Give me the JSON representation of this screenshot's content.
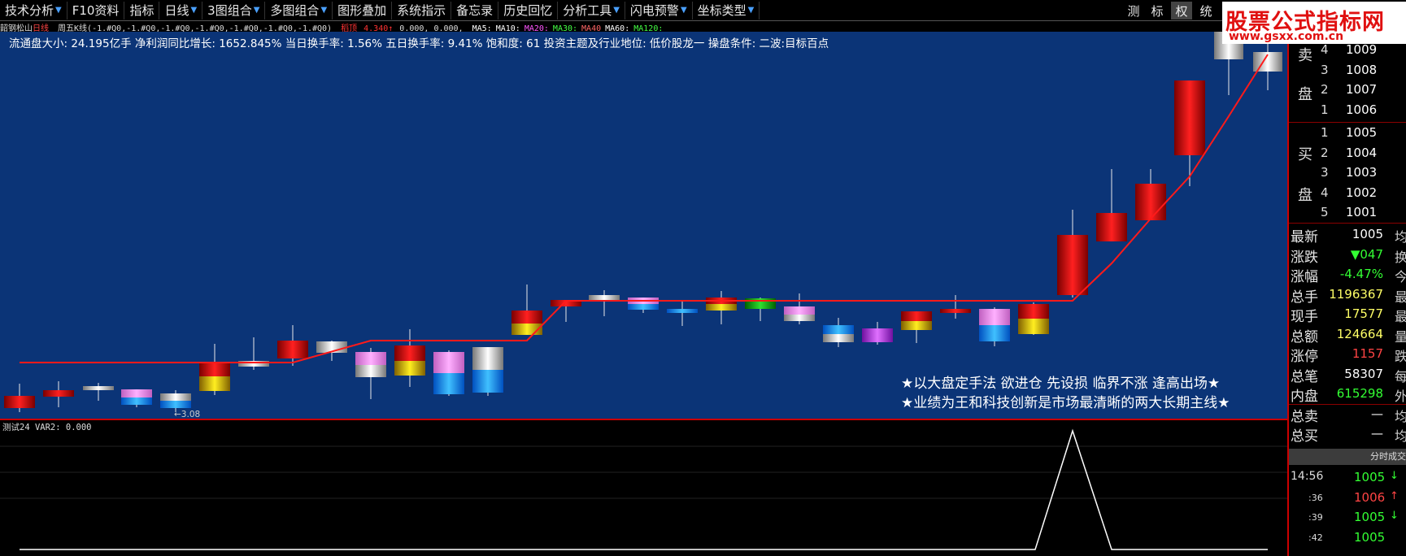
{
  "toolbar": {
    "items": [
      "技术分析",
      "F10资料",
      "指标",
      "日线",
      "3图组合",
      "多图组合",
      "图形叠加",
      "系统指示",
      "备忘录",
      "历史回忆",
      "分析工具",
      "闪电预警",
      "坐标类型"
    ],
    "right_items": [
      "测",
      "标",
      "权",
      "统"
    ]
  },
  "watermark": {
    "title": "股票公式指标网",
    "url": "www.gsxx.com.cn"
  },
  "infoline": {
    "stock_name": "韶钢松山",
    "period": "日线",
    "indicator": "周五K线(-1.#Q0,-1.#Q0,-1.#Q0,-1.#Q0,-1.#Q0,-1.#Q0,-1.#Q0)",
    "ma_label": "稻顶",
    "ma_value": "4.340↑",
    "ma_values": "0.000, 0.000,",
    "ma_list": [
      {
        "label": "MA5:",
        "color": "#ffffff"
      },
      {
        "label": "MA10:",
        "color": "#ffffff"
      },
      {
        "label": "MA20:",
        "color": "#ff55ff"
      },
      {
        "label": "MA30:",
        "color": "#44ff44"
      },
      {
        "label": "MA40",
        "color": "#ff6666"
      },
      {
        "label": "MA60:",
        "color": "#ffffff"
      },
      {
        "label": "MA120:",
        "color": "#44ff44"
      }
    ]
  },
  "main": {
    "data_line": "流通盘大小: 24.195亿手  净利润同比增长: 1652.845%  当日换手率: 1.56%  五日换手率: 9.41%  饱和度: 61  投资主题及行业地位: 低价股龙一  操盘条件: 二波:目标百点",
    "low_marker": "←3.08",
    "slogan1": "★以大盘定手法  欲进仓  先设损  临界不涨  逢高出场★",
    "slogan2": "★业绩为王和科技创新是市场最清晰的两大长期主线★"
  },
  "sub": {
    "title": "测试24  VAR2: 0.000"
  },
  "order_book": {
    "sell_label": "卖盘",
    "buy_label": "买盘",
    "sell": [
      {
        "level": "4",
        "price": "1009"
      },
      {
        "level": "3",
        "price": "1008"
      },
      {
        "level": "2",
        "price": "1007"
      },
      {
        "level": "1",
        "price": "1006"
      }
    ],
    "buy": [
      {
        "level": "1",
        "price": "1005"
      },
      {
        "level": "2",
        "price": "1004"
      },
      {
        "level": "3",
        "price": "1003"
      },
      {
        "level": "4",
        "price": "1002"
      },
      {
        "level": "5",
        "price": "1001"
      }
    ]
  },
  "stats": [
    {
      "label": "最新",
      "value": "1005",
      "color": "#ffffff",
      "cut": "均"
    },
    {
      "label": "涨跌",
      "value": "▼047",
      "color": "#33ff33",
      "cut": "换"
    },
    {
      "label": "涨幅",
      "value": "-4.47%",
      "color": "#33ff33",
      "cut": "今"
    },
    {
      "label": "总手",
      "value": "1196367",
      "color": "#ffff66",
      "cut": "最"
    },
    {
      "label": "现手",
      "value": "17577",
      "color": "#ffff66",
      "cut": "最"
    },
    {
      "label": "总额",
      "value": "124664",
      "color": "#ffff66",
      "cut": "量"
    },
    {
      "label": "涨停",
      "value": "1157",
      "color": "#ff4444",
      "cut": "跌"
    },
    {
      "label": "总笔",
      "value": "58307",
      "color": "#ffffff",
      "cut": "每"
    },
    {
      "label": "内盘",
      "value": "615298",
      "color": "#33ff33",
      "cut": "外"
    },
    {
      "label": "总卖",
      "value": "—",
      "color": "#ffffff",
      "cut": "均"
    },
    {
      "label": "总买",
      "value": "—",
      "color": "#ffffff",
      "cut": "均"
    }
  ],
  "ticks": {
    "header": "分时成交",
    "rows": [
      {
        "time": "14:56",
        "price": "1005",
        "arrow": "↓",
        "arrow_color": "#33ff33"
      },
      {
        "time": ":36",
        "price": "1006",
        "arrow": "↑",
        "arrow_color": "#ff4444"
      },
      {
        "time": ":39",
        "price": "1005",
        "arrow": "↓",
        "arrow_color": "#33ff33"
      },
      {
        "time": ":42",
        "price": "1005",
        "arrow": "",
        "arrow_color": "#33ff33"
      }
    ]
  }
}
